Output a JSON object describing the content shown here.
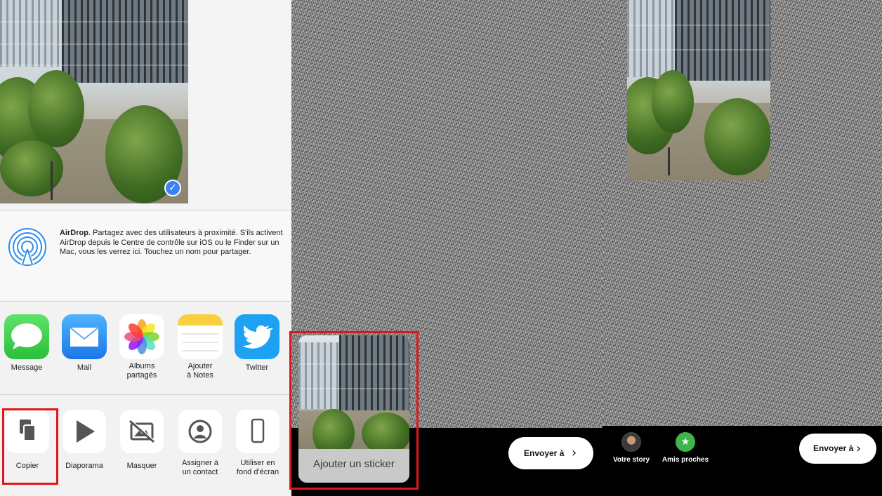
{
  "share_sheet": {
    "airdrop": {
      "title": "AirDrop",
      "description": ". Partagez avec des utilisateurs à proximité. S'ils activent AirDrop depuis le Centre de contrôle sur iOS ou le Finder sur un Mac, vous les verrez ici. Touchez un nom pour partager."
    },
    "apps": [
      {
        "label": "Message",
        "icon": "messages-icon"
      },
      {
        "label": "Mail",
        "icon": "mail-icon"
      },
      {
        "label": "Albums\npartagés",
        "icon": "photos-icon"
      },
      {
        "label": "Ajouter\nà Notes",
        "icon": "notes-icon"
      },
      {
        "label": "Twitter",
        "icon": "twitter-icon"
      }
    ],
    "actions": [
      {
        "label": "Copier",
        "icon": "copy-icon"
      },
      {
        "label": "Diaporama",
        "icon": "play-icon"
      },
      {
        "label": "Masquer",
        "icon": "hide-icon"
      },
      {
        "label": "Assigner à\nun contact",
        "icon": "contact-icon"
      },
      {
        "label": "Utiliser en\nfond d'écran",
        "icon": "phone-icon"
      }
    ]
  },
  "sticker": {
    "label": "Ajouter un sticker"
  },
  "story_bar": {
    "send_label": "Envoyer à",
    "your_story": "Votre story",
    "close_friends": "Amis proches"
  },
  "right_panel": {
    "send_label": "Envoyer à"
  },
  "colors": {
    "highlight": "#e0171a",
    "twitter": "#1da1f2",
    "messages": "#3dc84c",
    "mail": "#2f8cf0",
    "check": "#3a82f7"
  }
}
